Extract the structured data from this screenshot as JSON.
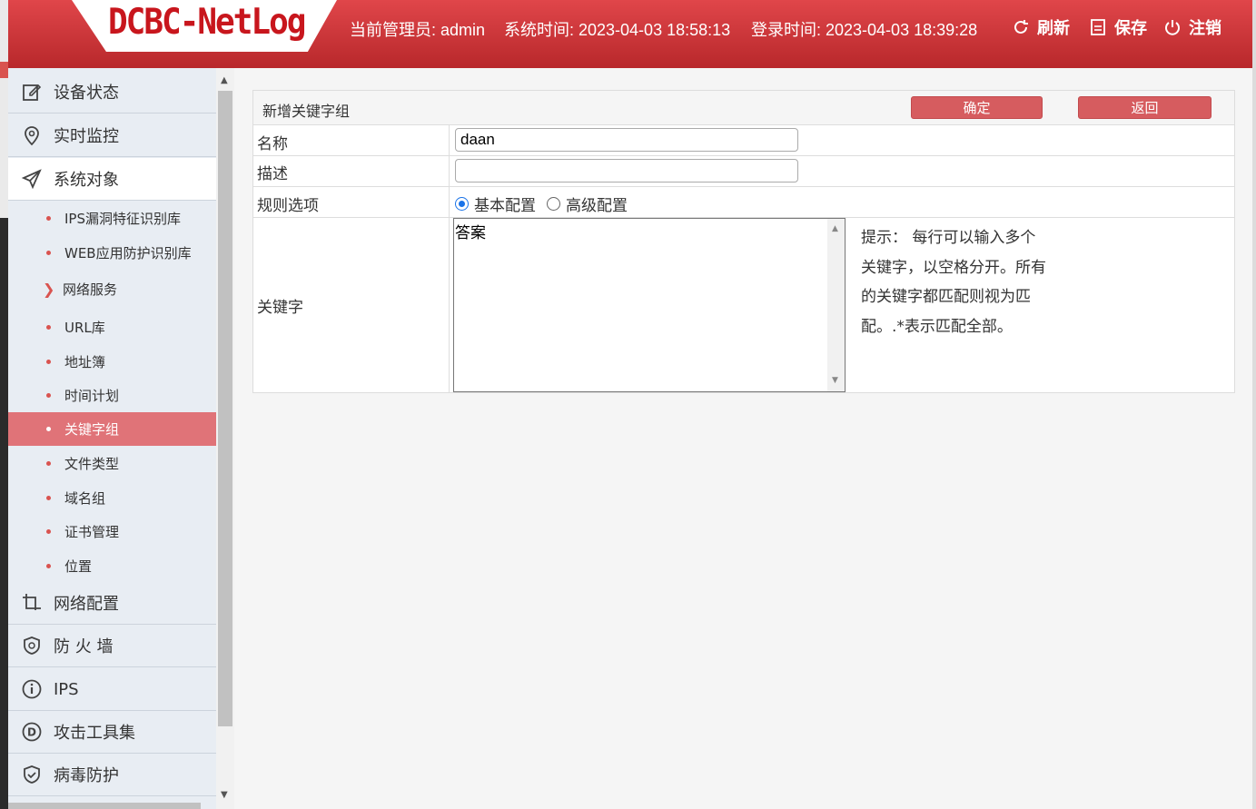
{
  "header": {
    "logo": "DCBC-NetLog",
    "admin_label": "当前管理员: admin",
    "system_time": "系统时间: 2023-04-03 18:58:13",
    "login_time": "登录时间: 2023-04-03 18:39:28",
    "refresh": "刷新",
    "save": "保存",
    "logout": "注销"
  },
  "sidebar": {
    "main1": "设备状态",
    "main2": "实时监控",
    "main3": "系统对象",
    "subs": [
      "IPS漏洞特征识别库",
      "WEB应用防护识别库",
      "网络服务",
      "URL库",
      "地址簿",
      "时间计划",
      "关键字组",
      "文件类型",
      "域名组",
      "证书管理",
      "位置"
    ],
    "main4": "网络配置",
    "main5": "防 火 墙",
    "main6": "IPS",
    "main7": "攻击工具集",
    "main8": "病毒防护"
  },
  "form": {
    "title": "新增关键字组",
    "confirm": "确定",
    "back": "返回",
    "name_label": "名称",
    "name_value": "daan",
    "desc_label": "描述",
    "desc_value": "",
    "rule_label": "规则选项",
    "rule_basic": "基本配置",
    "rule_advanced": "高级配置",
    "keyword_label": "关键字",
    "keyword_value": "答案",
    "hint_lines": [
      "提示：  每行可以输入多个",
      "关键字，以空格分开。所有",
      "的关键字都匹配则视为匹",
      "配。.*表示匹配全部。"
    ]
  }
}
